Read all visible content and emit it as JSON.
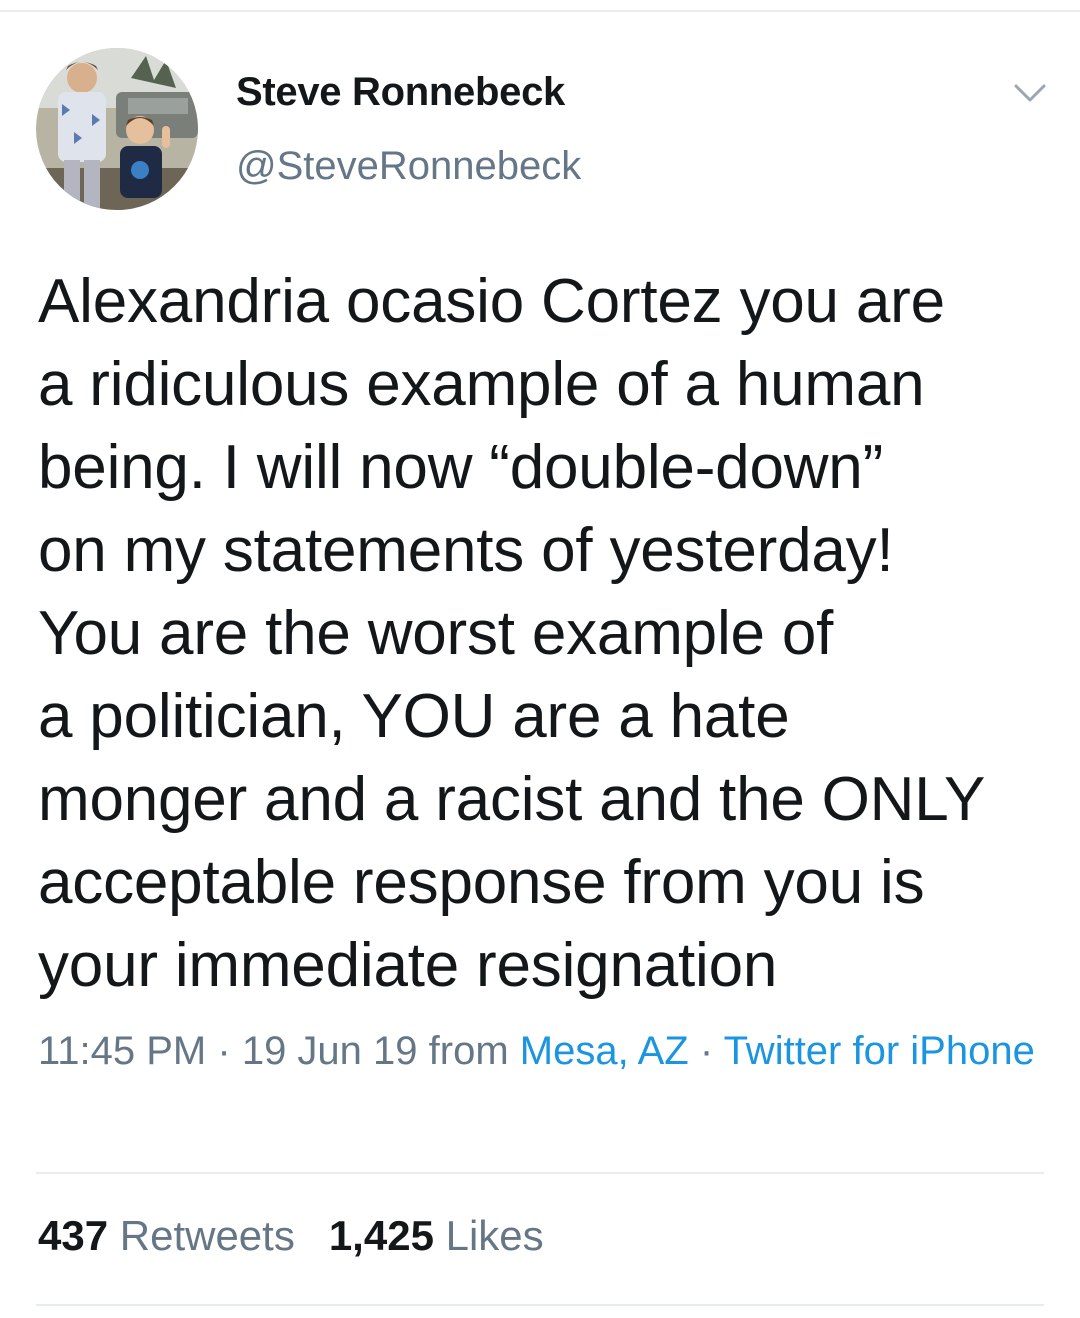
{
  "tweet": {
    "author": {
      "display_name": "Steve Ronnebeck",
      "handle": "@SteveRonnebeck"
    },
    "text": "Alexandria ocasio Cortez you are\na ridiculous example of a human\nbeing. I will now “double-down”\non my statements of yesterday!\nYou are the worst example of\na politician, YOU are a hate\nmonger and a racist and the ONLY\nacceptable response from you is\nyour immediate resignation",
    "time": "11:45 PM",
    "separator": "·",
    "date": "19 Jun 19",
    "from_label": "from",
    "location": "Mesa, AZ",
    "source": "Twitter for iPhone",
    "retweets_count": "437",
    "retweets_label": "Retweets",
    "likes_count": "1,425",
    "likes_label": "Likes"
  },
  "icons": {
    "menu": "chevron-down-icon"
  },
  "colors": {
    "text": "#14171a",
    "secondary": "#657786",
    "link": "#1b95e0",
    "divider": "#e6ecf0"
  }
}
